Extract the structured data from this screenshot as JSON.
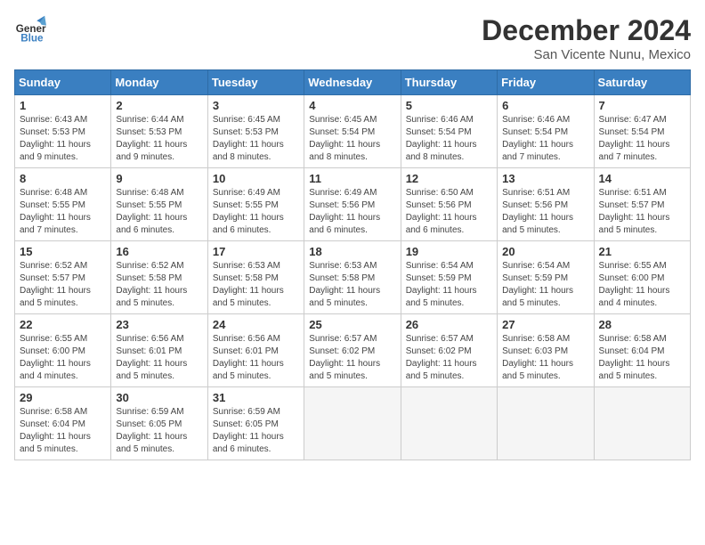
{
  "header": {
    "logo_line1": "General",
    "logo_line2": "Blue",
    "month": "December 2024",
    "location": "San Vicente Nunu, Mexico"
  },
  "days_of_week": [
    "Sunday",
    "Monday",
    "Tuesday",
    "Wednesday",
    "Thursday",
    "Friday",
    "Saturday"
  ],
  "weeks": [
    [
      {
        "day": "1",
        "details": "Sunrise: 6:43 AM\nSunset: 5:53 PM\nDaylight: 11 hours\nand 9 minutes."
      },
      {
        "day": "2",
        "details": "Sunrise: 6:44 AM\nSunset: 5:53 PM\nDaylight: 11 hours\nand 9 minutes."
      },
      {
        "day": "3",
        "details": "Sunrise: 6:45 AM\nSunset: 5:53 PM\nDaylight: 11 hours\nand 8 minutes."
      },
      {
        "day": "4",
        "details": "Sunrise: 6:45 AM\nSunset: 5:54 PM\nDaylight: 11 hours\nand 8 minutes."
      },
      {
        "day": "5",
        "details": "Sunrise: 6:46 AM\nSunset: 5:54 PM\nDaylight: 11 hours\nand 8 minutes."
      },
      {
        "day": "6",
        "details": "Sunrise: 6:46 AM\nSunset: 5:54 PM\nDaylight: 11 hours\nand 7 minutes."
      },
      {
        "day": "7",
        "details": "Sunrise: 6:47 AM\nSunset: 5:54 PM\nDaylight: 11 hours\nand 7 minutes."
      }
    ],
    [
      {
        "day": "8",
        "details": "Sunrise: 6:48 AM\nSunset: 5:55 PM\nDaylight: 11 hours\nand 7 minutes."
      },
      {
        "day": "9",
        "details": "Sunrise: 6:48 AM\nSunset: 5:55 PM\nDaylight: 11 hours\nand 6 minutes."
      },
      {
        "day": "10",
        "details": "Sunrise: 6:49 AM\nSunset: 5:55 PM\nDaylight: 11 hours\nand 6 minutes."
      },
      {
        "day": "11",
        "details": "Sunrise: 6:49 AM\nSunset: 5:56 PM\nDaylight: 11 hours\nand 6 minutes."
      },
      {
        "day": "12",
        "details": "Sunrise: 6:50 AM\nSunset: 5:56 PM\nDaylight: 11 hours\nand 6 minutes."
      },
      {
        "day": "13",
        "details": "Sunrise: 6:51 AM\nSunset: 5:56 PM\nDaylight: 11 hours\nand 5 minutes."
      },
      {
        "day": "14",
        "details": "Sunrise: 6:51 AM\nSunset: 5:57 PM\nDaylight: 11 hours\nand 5 minutes."
      }
    ],
    [
      {
        "day": "15",
        "details": "Sunrise: 6:52 AM\nSunset: 5:57 PM\nDaylight: 11 hours\nand 5 minutes."
      },
      {
        "day": "16",
        "details": "Sunrise: 6:52 AM\nSunset: 5:58 PM\nDaylight: 11 hours\nand 5 minutes."
      },
      {
        "day": "17",
        "details": "Sunrise: 6:53 AM\nSunset: 5:58 PM\nDaylight: 11 hours\nand 5 minutes."
      },
      {
        "day": "18",
        "details": "Sunrise: 6:53 AM\nSunset: 5:58 PM\nDaylight: 11 hours\nand 5 minutes."
      },
      {
        "day": "19",
        "details": "Sunrise: 6:54 AM\nSunset: 5:59 PM\nDaylight: 11 hours\nand 5 minutes."
      },
      {
        "day": "20",
        "details": "Sunrise: 6:54 AM\nSunset: 5:59 PM\nDaylight: 11 hours\nand 5 minutes."
      },
      {
        "day": "21",
        "details": "Sunrise: 6:55 AM\nSunset: 6:00 PM\nDaylight: 11 hours\nand 4 minutes."
      }
    ],
    [
      {
        "day": "22",
        "details": "Sunrise: 6:55 AM\nSunset: 6:00 PM\nDaylight: 11 hours\nand 4 minutes."
      },
      {
        "day": "23",
        "details": "Sunrise: 6:56 AM\nSunset: 6:01 PM\nDaylight: 11 hours\nand 5 minutes."
      },
      {
        "day": "24",
        "details": "Sunrise: 6:56 AM\nSunset: 6:01 PM\nDaylight: 11 hours\nand 5 minutes."
      },
      {
        "day": "25",
        "details": "Sunrise: 6:57 AM\nSunset: 6:02 PM\nDaylight: 11 hours\nand 5 minutes."
      },
      {
        "day": "26",
        "details": "Sunrise: 6:57 AM\nSunset: 6:02 PM\nDaylight: 11 hours\nand 5 minutes."
      },
      {
        "day": "27",
        "details": "Sunrise: 6:58 AM\nSunset: 6:03 PM\nDaylight: 11 hours\nand 5 minutes."
      },
      {
        "day": "28",
        "details": "Sunrise: 6:58 AM\nSunset: 6:04 PM\nDaylight: 11 hours\nand 5 minutes."
      }
    ],
    [
      {
        "day": "29",
        "details": "Sunrise: 6:58 AM\nSunset: 6:04 PM\nDaylight: 11 hours\nand 5 minutes."
      },
      {
        "day": "30",
        "details": "Sunrise: 6:59 AM\nSunset: 6:05 PM\nDaylight: 11 hours\nand 5 minutes."
      },
      {
        "day": "31",
        "details": "Sunrise: 6:59 AM\nSunset: 6:05 PM\nDaylight: 11 hours\nand 6 minutes."
      },
      {
        "day": "",
        "details": ""
      },
      {
        "day": "",
        "details": ""
      },
      {
        "day": "",
        "details": ""
      },
      {
        "day": "",
        "details": ""
      }
    ]
  ]
}
